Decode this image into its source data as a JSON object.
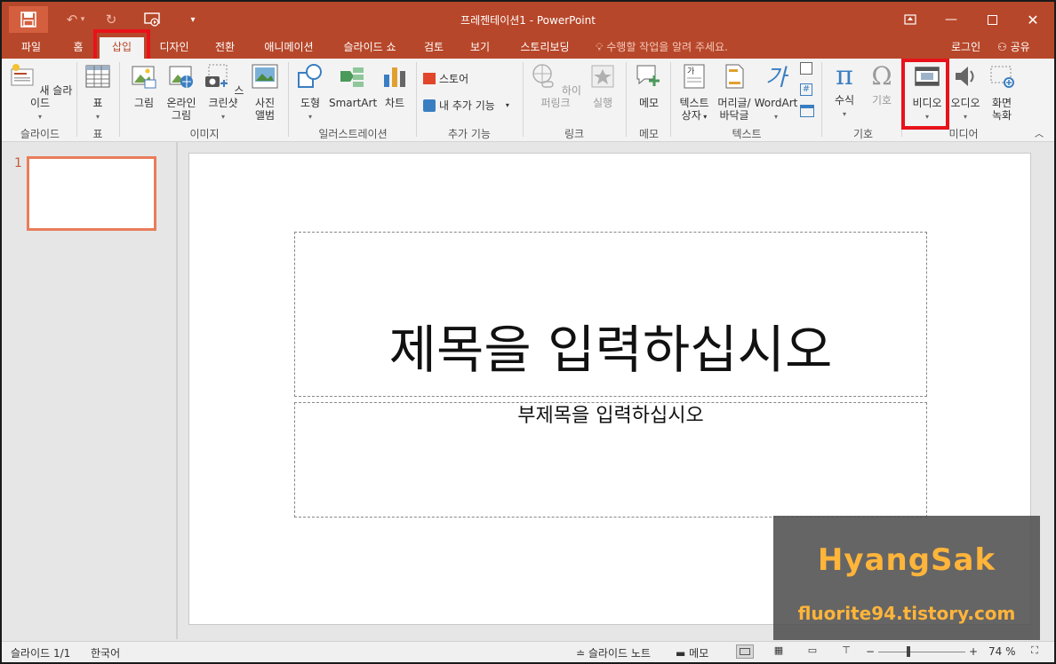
{
  "window": {
    "title": "프레젠테이션1 - PowerPoint"
  },
  "tabs": [
    "파일",
    "홈",
    "삽입",
    "디자인",
    "전환",
    "애니메이션",
    "슬라이드 쇼",
    "검토",
    "보기",
    "스토리보딩"
  ],
  "active_tab": "삽입",
  "tell_me": "수행할 작업을 알려 주세요.",
  "account": {
    "login": "로그인",
    "share": "공유"
  },
  "ribbon": {
    "new_slide": "새 슬라이드",
    "table": "표",
    "picture": "그림",
    "online_picture_1": "온라인",
    "online_picture_2": "그림",
    "screenshot": "스크린샷",
    "album_1": "사진",
    "album_2": "앨범",
    "shapes": "도형",
    "smartart": "SmartArt",
    "chart": "차트",
    "store": "스토어",
    "my_addins": "내 추가 기능",
    "hyperlink": "하이퍼링크",
    "action": "실행",
    "comment": "메모",
    "textbox_1": "텍스트",
    "textbox_2": "상자",
    "header_1": "머리글/",
    "header_2": "바닥글",
    "wordart": "WordArt",
    "equation": "수식",
    "symbol": "기호",
    "video": "비디오",
    "audio": "오디오",
    "screen_rec_1": "화면",
    "screen_rec_2": "녹화",
    "groups": {
      "slides": "슬라이드",
      "tables": "표",
      "images": "이미지",
      "illustrations": "일러스트레이션",
      "addins": "추가 기능",
      "links": "링크",
      "comments": "메모",
      "text": "텍스트",
      "symbols": "기호",
      "media": "미디어"
    }
  },
  "thumbnails": {
    "number": "1"
  },
  "slide": {
    "title_placeholder": "제목을 입력하십시오",
    "subtitle_placeholder": "부제목을 입력하십시오"
  },
  "watermark": {
    "name": "HyangSak",
    "url": "fluorite94.tistory.com"
  },
  "status": {
    "slide_count": "슬라이드 1/1",
    "language": "한국어",
    "notes": "슬라이드 노트",
    "comments": "메모",
    "zoom": "74 %"
  },
  "colors": {
    "accent": "#b7472a",
    "highlight": "#e8121b"
  }
}
